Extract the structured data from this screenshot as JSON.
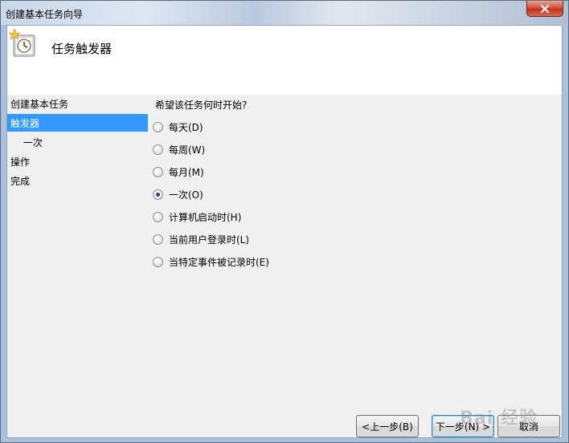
{
  "window": {
    "title": "创建基本任务向导"
  },
  "header": {
    "title": "任务触发器"
  },
  "steps": [
    {
      "label": "创建基本任务"
    },
    {
      "label": "触发器"
    },
    {
      "label": "一次"
    },
    {
      "label": "操作"
    },
    {
      "label": "完成"
    }
  ],
  "question": "希望该任务何时开始?",
  "options": [
    {
      "label": "每天(D)"
    },
    {
      "label": "每周(W)"
    },
    {
      "label": "每月(M)"
    },
    {
      "label": "一次(O)"
    },
    {
      "label": "计算机启动时(H)"
    },
    {
      "label": "当前用户登录时(L)"
    },
    {
      "label": "当特定事件被记录时(E)"
    }
  ],
  "selected_option": "一次(O)",
  "buttons": {
    "back": "<上一步(B)",
    "next": "下一步(N) >",
    "cancel": "取消"
  },
  "watermark": "Bai 经验"
}
